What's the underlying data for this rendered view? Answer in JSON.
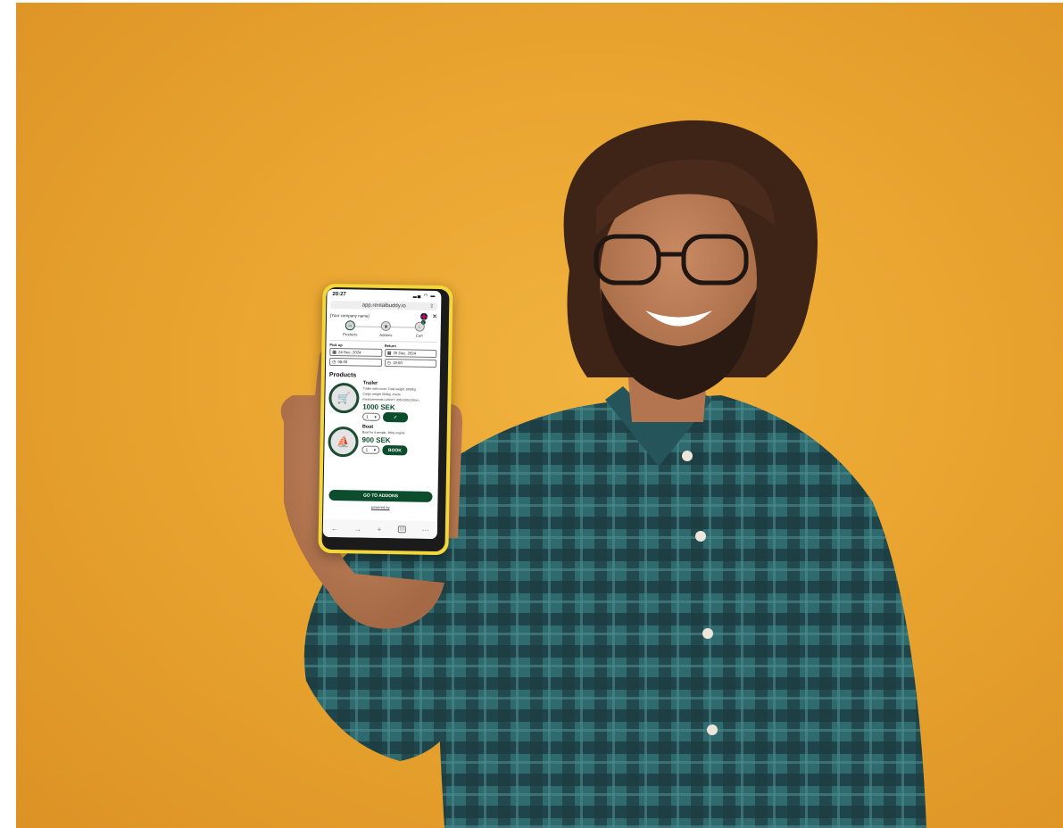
{
  "photo": {
    "description_colors": {
      "background": "#e9a530",
      "shirt": "#2f5e63",
      "phone_case": "#f2d63a",
      "accent": "#0b4d2c"
    }
  },
  "status": {
    "time": "20:27",
    "icons": "▂▄ ◠ ▬"
  },
  "browser": {
    "url": "app.rentalbuddy.io",
    "share_icon": "share-icon",
    "nav_back": "←",
    "nav_forward": "→",
    "new_tab": "+",
    "tabs": "10",
    "more": "⋯"
  },
  "header": {
    "company": "[Your company name]",
    "close": "✕"
  },
  "steps": [
    {
      "label": "Products",
      "icon": "trailer-icon"
    },
    {
      "label": "Addons",
      "icon": "addons-icon"
    },
    {
      "label": "Cart",
      "icon": "cart-icon",
      "badge": "1"
    }
  ],
  "booking": {
    "pickup_label": "Pick up",
    "return_label": "Return",
    "pickup_date": "24 Dec. 2024",
    "pickup_time": "08:00",
    "return_date": "25 Dec. 2024",
    "return_time": "19:00"
  },
  "products_title": "Products",
  "products": [
    {
      "name": "Trailer",
      "desc1": "Trailer with cover. Total weight 1000kg.",
      "desc2": "Cargo weight 550kg. Inside",
      "desc3": "measurements LxWxH: 305x150x150cm.",
      "price": "1000 SEK",
      "qty": "1",
      "action": "✓"
    },
    {
      "name": "Boat",
      "desc1": "Boat for 4 people, 30hp engine",
      "desc2": "",
      "desc3": "",
      "price": "900 SEK",
      "qty": "1",
      "action": "BOOK"
    }
  ],
  "cta": "GO TO ADDONS",
  "powered": "powered by"
}
